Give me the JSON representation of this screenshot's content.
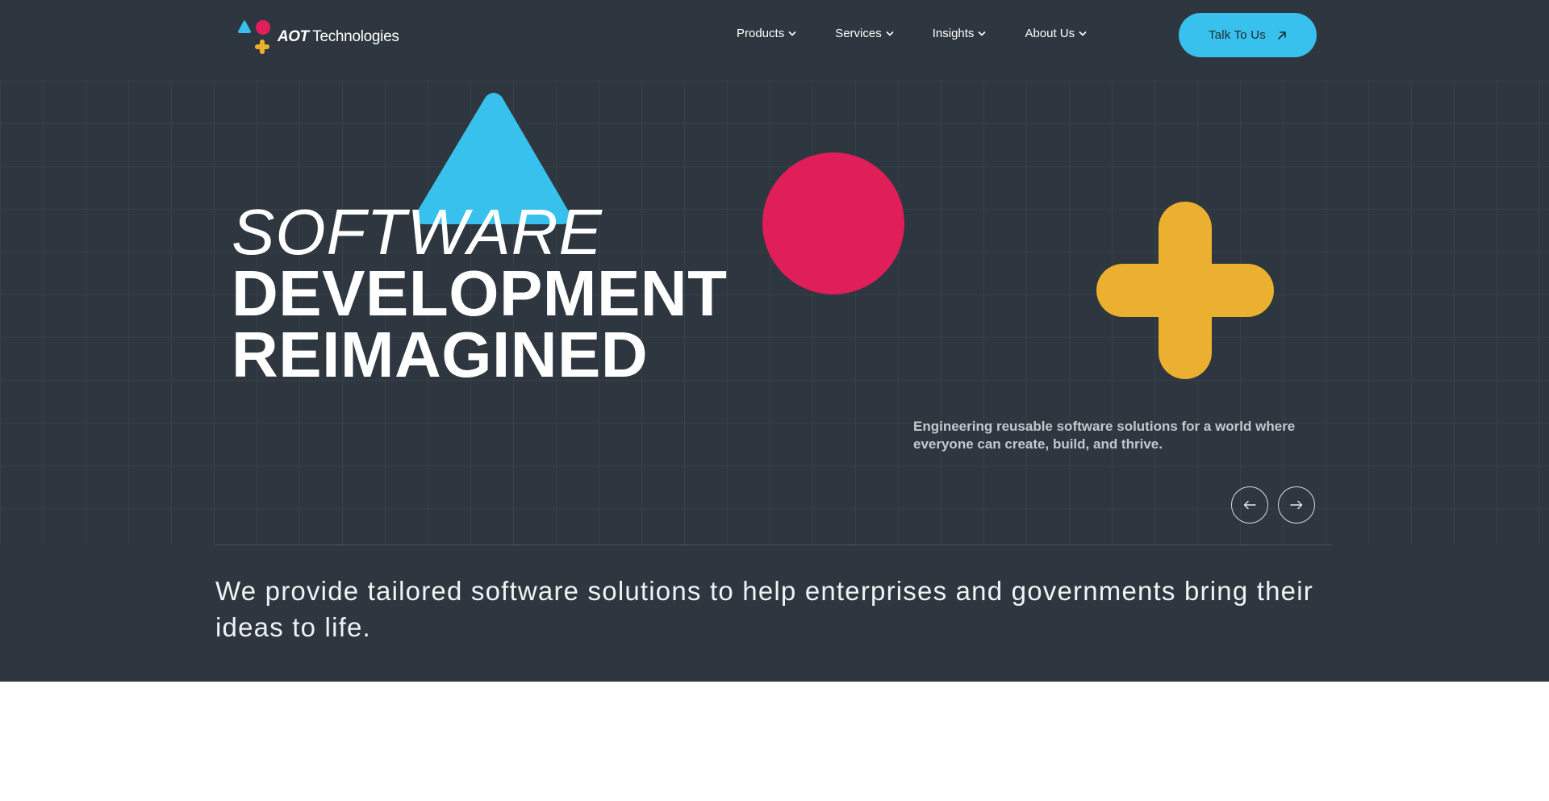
{
  "header": {
    "logo_wordmark_bold": "AOT",
    "logo_wordmark": "Technologies",
    "nav": [
      {
        "label": "Products"
      },
      {
        "label": "Services"
      },
      {
        "label": "Insights"
      },
      {
        "label": "About Us"
      }
    ],
    "cta_label": "Talk To Us"
  },
  "hero": {
    "headline_line1": "SOFTWARE",
    "headline_line2": "DEVELOPMENT",
    "headline_line3": "REIMAGINED",
    "tagline": "Engineering reusable software solutions for a world where everyone can create, build, and thrive.",
    "intro": "We provide tailored software solutions to help enterprises and governments bring their ideas to life."
  },
  "colors": {
    "background": "#2e373f",
    "accent_blue": "#38c1ec",
    "accent_pink": "#e01e5a",
    "accent_yellow": "#ecb030"
  },
  "icons": {
    "logo": "triangle-circle-plus-logo-icon",
    "dropdown": "chevron-down-icon",
    "cta": "arrow-up-right-icon",
    "prev": "arrow-left-icon",
    "next": "arrow-right-icon"
  }
}
